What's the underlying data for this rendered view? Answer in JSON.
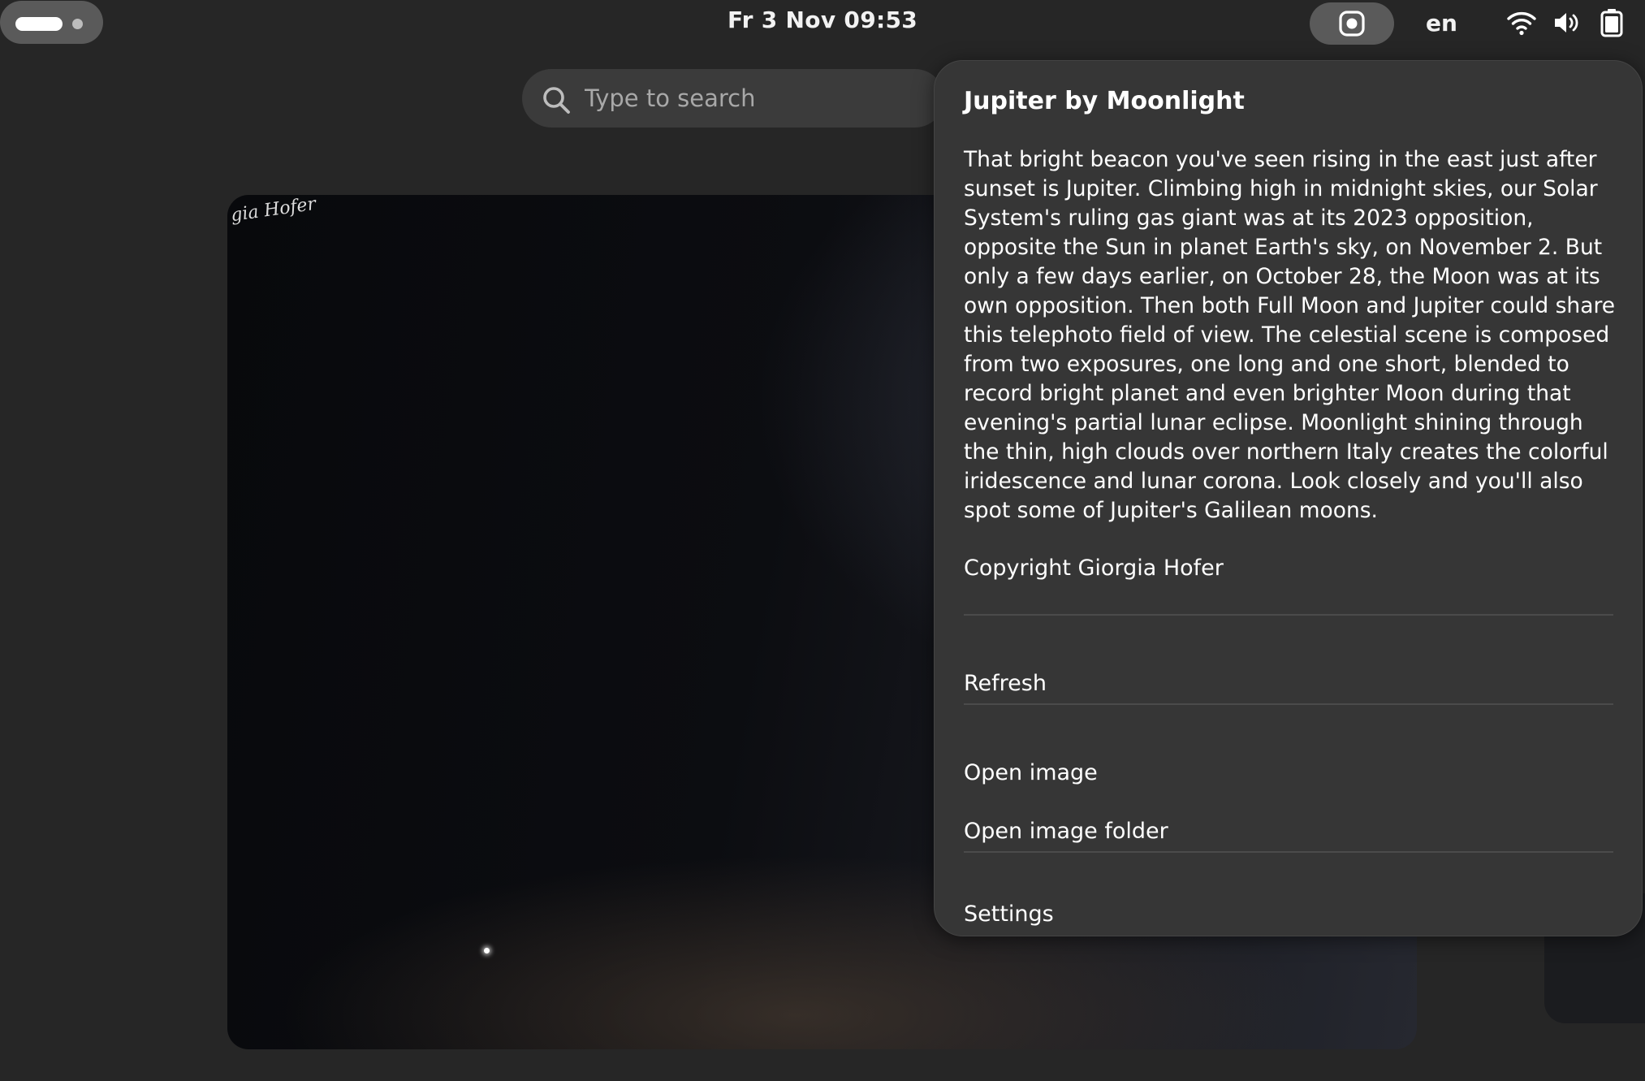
{
  "topbar": {
    "activities_label": "",
    "clock": "Fr 3 Nov  09:53",
    "language": "en",
    "icons": [
      "screencast-icon",
      "wifi-icon",
      "volume-icon",
      "battery-icon"
    ]
  },
  "search": {
    "placeholder": "Type to search",
    "value": ""
  },
  "background_window": {
    "signature_text": "gia Hofer"
  },
  "popover": {
    "title": "Jupiter by Moonlight",
    "description": "That bright beacon you've seen rising in the east just after sunset is Jupiter. Climbing high in midnight skies, our Solar System's ruling gas giant was at its 2023 opposition, opposite the Sun in planet Earth's sky, on November 2. But only a few days earlier, on October 28, the Moon was at its own opposition. Then both Full Moon and Jupiter could share this telephoto field of view. The celestial scene is composed from two exposures, one long and one short, blended to record bright planet and even brighter Moon during that evening's partial lunar eclipse. Moonlight shining through the thin, high clouds over northern Italy creates the colorful iridescence and lunar corona. Look closely and you'll also spot some of Jupiter's Galilean moons.",
    "copyright": "Copyright Giorgia Hofer",
    "menu": {
      "refresh": "Refresh",
      "open_image": "Open image",
      "open_image_folder": "Open image folder",
      "settings": "Settings"
    }
  },
  "colors": {
    "panel_bg": "#262626",
    "popover_bg": "#363636",
    "separator": "#4b4b4b",
    "text": "#ffffff",
    "placeholder": "#a8a8a8"
  }
}
